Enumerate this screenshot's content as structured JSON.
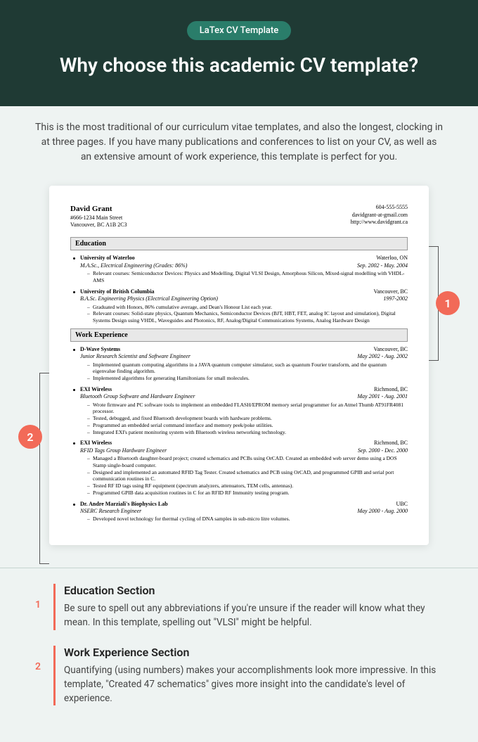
{
  "badge": "LaTex CV Template",
  "heading": "Why choose this academic CV template?",
  "intro": "This is the most traditional of our curriculum vitae templates, and also the longest, clocking in at three pages. If you have many publications and conferences to list on your CV, as well as an extensive amount of work experience, this template is perfect for you.",
  "cv": {
    "name": "David Grant",
    "addr1": "#666-1234 Main Street",
    "addr2": "Vancouver, BC A1B 2C3",
    "phone": "604-555-5555",
    "email": "davidgrant-at-gmail.com",
    "web": "http://www.davidgrant.ca",
    "sec_edu": "Education",
    "sec_work": "Work Experience",
    "edu": [
      {
        "school": "University of Waterloo",
        "loc": "Waterloo, ON",
        "degree": "M.A.Sc., Electrical Engineering (Grades: 86%)",
        "dates": "Sep. 2002 - May. 2004",
        "bullets": [
          "Relevant courses: Semiconductor Devices: Physics and Modelling, Digital VLSI Design, Amorphous Silicon, Mixed-signal modelling with VHDL-AMS"
        ]
      },
      {
        "school": "University of British Columbia",
        "loc": "Vancouver, BC",
        "degree": "B.A.Sc. Engineering Physics (Electrical Engineering Option)",
        "dates": "1997-2002",
        "bullets": [
          "Graduated with Honors, 86% cumulative average, and Dean's Honour List each year.",
          "Relevant courses: Solid-state physics, Quantum Mechanics, Semiconductor Devices (BJT, HBT, FET, analog IC layout and simulation), Digital Systems Design using VHDL, Waveguides and Photonics, RF, Analog/Digital Communications Systems, Analog Hardware Design"
        ]
      }
    ],
    "work": [
      {
        "org": "D-Wave Systems",
        "loc": "Vancouver, BC",
        "role": "Junior Research Scientist and Software Engineer",
        "dates": "May 2002 - Aug. 2002",
        "bullets": [
          "Implemented quantum computing algorithms in a JAVA quantum computer simulator, such as quantum Fourier transform, and the quantum eigenvalue finding algorithm.",
          "Implemented algorithms for generating Hamiltonians for small molecules."
        ]
      },
      {
        "org": "EXI Wireless",
        "loc": "Richmond, BC",
        "role": "Bluetooth Group Software and Hardware Engineer",
        "dates": "May 2001 - Aug. 2001",
        "bullets": [
          "Wrote firmware and PC software tools to implement an embedded FLASH/EPROM memory serial programmer for an Atmel Thumb AT91FR4081 processor.",
          "Tested, debugged, and fixed Bluetooth development boards with hardware problems.",
          "Programmed an embedded serial command interface and memory peek/poke utilities.",
          "Integrated EXI's patient monitoring system with Bluetooth wireless networking technology."
        ]
      },
      {
        "org": "EXI Wireless",
        "loc": "Richmond, BC",
        "role": "RFID Tags Group Hardware Engineer",
        "dates": "Sep. 2000 - Dec. 2000",
        "bullets": [
          "Managed a Bluetooth daughter-board project; created schematics and PCBs using OrCAD. Created an embedded web server demo using a DOS Stamp single-board computer.",
          "Designed and implemented an automated RFID Tag Tester. Created schematics and PCB using OrCAD, and programmed GPIB and serial port communication routines in C.",
          "Tested RF ID tags using RF equipment (spectrum analyzers, attenuators, TEM cells, antennas).",
          "Programmed GPIB data acquisition routines in C for an RFID RF Immunity testing program."
        ]
      },
      {
        "org": "Dr. Andre Marziali's Biophysics Lab",
        "loc": "UBC",
        "role": "NSERC Research Engineer",
        "dates": "May 2000 - Aug. 2000",
        "bullets": [
          "Developed novel technology for thermal cycling of DNA samples in sub-micro litre volumes."
        ]
      }
    ]
  },
  "callouts": {
    "n1": "1",
    "n2": "2"
  },
  "notes": [
    {
      "num": "1",
      "title": "Education Section",
      "text": "Be sure to spell out any abbreviations if you're unsure if the reader will know what they mean. In this template, spelling out \"VLSI\" might be helpful."
    },
    {
      "num": "2",
      "title": "Work Experience Section",
      "text": "Quantifying (using numbers) makes your accomplishments look more impressive. In this template, \"Created 47 schematics\" gives more insight into the candidate's level of experience."
    }
  ]
}
